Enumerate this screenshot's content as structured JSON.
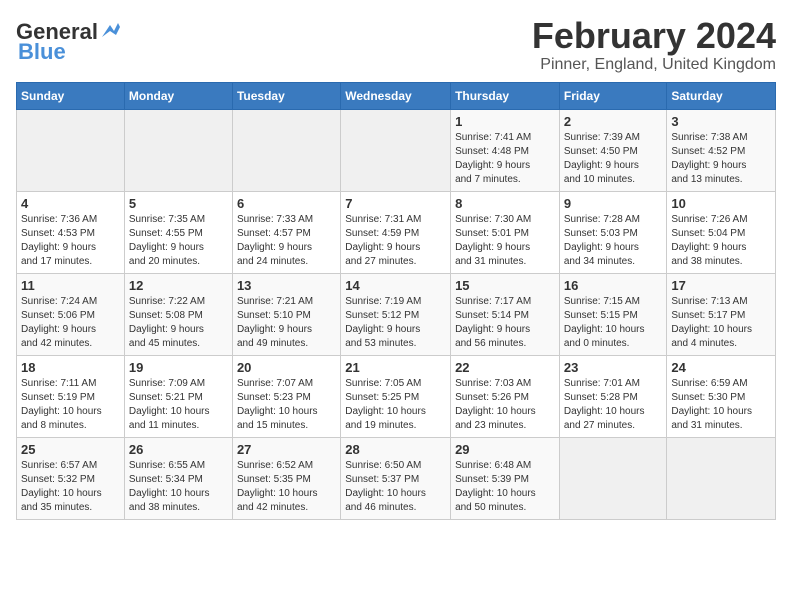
{
  "header": {
    "logo_line1": "General",
    "logo_line2": "Blue",
    "title": "February 2024",
    "subtitle": "Pinner, England, United Kingdom"
  },
  "calendar": {
    "columns": [
      "Sunday",
      "Monday",
      "Tuesday",
      "Wednesday",
      "Thursday",
      "Friday",
      "Saturday"
    ],
    "weeks": [
      [
        {
          "day": "",
          "info": ""
        },
        {
          "day": "",
          "info": ""
        },
        {
          "day": "",
          "info": ""
        },
        {
          "day": "",
          "info": ""
        },
        {
          "day": "1",
          "info": "Sunrise: 7:41 AM\nSunset: 4:48 PM\nDaylight: 9 hours\nand 7 minutes."
        },
        {
          "day": "2",
          "info": "Sunrise: 7:39 AM\nSunset: 4:50 PM\nDaylight: 9 hours\nand 10 minutes."
        },
        {
          "day": "3",
          "info": "Sunrise: 7:38 AM\nSunset: 4:52 PM\nDaylight: 9 hours\nand 13 minutes."
        }
      ],
      [
        {
          "day": "4",
          "info": "Sunrise: 7:36 AM\nSunset: 4:53 PM\nDaylight: 9 hours\nand 17 minutes."
        },
        {
          "day": "5",
          "info": "Sunrise: 7:35 AM\nSunset: 4:55 PM\nDaylight: 9 hours\nand 20 minutes."
        },
        {
          "day": "6",
          "info": "Sunrise: 7:33 AM\nSunset: 4:57 PM\nDaylight: 9 hours\nand 24 minutes."
        },
        {
          "day": "7",
          "info": "Sunrise: 7:31 AM\nSunset: 4:59 PM\nDaylight: 9 hours\nand 27 minutes."
        },
        {
          "day": "8",
          "info": "Sunrise: 7:30 AM\nSunset: 5:01 PM\nDaylight: 9 hours\nand 31 minutes."
        },
        {
          "day": "9",
          "info": "Sunrise: 7:28 AM\nSunset: 5:03 PM\nDaylight: 9 hours\nand 34 minutes."
        },
        {
          "day": "10",
          "info": "Sunrise: 7:26 AM\nSunset: 5:04 PM\nDaylight: 9 hours\nand 38 minutes."
        }
      ],
      [
        {
          "day": "11",
          "info": "Sunrise: 7:24 AM\nSunset: 5:06 PM\nDaylight: 9 hours\nand 42 minutes."
        },
        {
          "day": "12",
          "info": "Sunrise: 7:22 AM\nSunset: 5:08 PM\nDaylight: 9 hours\nand 45 minutes."
        },
        {
          "day": "13",
          "info": "Sunrise: 7:21 AM\nSunset: 5:10 PM\nDaylight: 9 hours\nand 49 minutes."
        },
        {
          "day": "14",
          "info": "Sunrise: 7:19 AM\nSunset: 5:12 PM\nDaylight: 9 hours\nand 53 minutes."
        },
        {
          "day": "15",
          "info": "Sunrise: 7:17 AM\nSunset: 5:14 PM\nDaylight: 9 hours\nand 56 minutes."
        },
        {
          "day": "16",
          "info": "Sunrise: 7:15 AM\nSunset: 5:15 PM\nDaylight: 10 hours\nand 0 minutes."
        },
        {
          "day": "17",
          "info": "Sunrise: 7:13 AM\nSunset: 5:17 PM\nDaylight: 10 hours\nand 4 minutes."
        }
      ],
      [
        {
          "day": "18",
          "info": "Sunrise: 7:11 AM\nSunset: 5:19 PM\nDaylight: 10 hours\nand 8 minutes."
        },
        {
          "day": "19",
          "info": "Sunrise: 7:09 AM\nSunset: 5:21 PM\nDaylight: 10 hours\nand 11 minutes."
        },
        {
          "day": "20",
          "info": "Sunrise: 7:07 AM\nSunset: 5:23 PM\nDaylight: 10 hours\nand 15 minutes."
        },
        {
          "day": "21",
          "info": "Sunrise: 7:05 AM\nSunset: 5:25 PM\nDaylight: 10 hours\nand 19 minutes."
        },
        {
          "day": "22",
          "info": "Sunrise: 7:03 AM\nSunset: 5:26 PM\nDaylight: 10 hours\nand 23 minutes."
        },
        {
          "day": "23",
          "info": "Sunrise: 7:01 AM\nSunset: 5:28 PM\nDaylight: 10 hours\nand 27 minutes."
        },
        {
          "day": "24",
          "info": "Sunrise: 6:59 AM\nSunset: 5:30 PM\nDaylight: 10 hours\nand 31 minutes."
        }
      ],
      [
        {
          "day": "25",
          "info": "Sunrise: 6:57 AM\nSunset: 5:32 PM\nDaylight: 10 hours\nand 35 minutes."
        },
        {
          "day": "26",
          "info": "Sunrise: 6:55 AM\nSunset: 5:34 PM\nDaylight: 10 hours\nand 38 minutes."
        },
        {
          "day": "27",
          "info": "Sunrise: 6:52 AM\nSunset: 5:35 PM\nDaylight: 10 hours\nand 42 minutes."
        },
        {
          "day": "28",
          "info": "Sunrise: 6:50 AM\nSunset: 5:37 PM\nDaylight: 10 hours\nand 46 minutes."
        },
        {
          "day": "29",
          "info": "Sunrise: 6:48 AM\nSunset: 5:39 PM\nDaylight: 10 hours\nand 50 minutes."
        },
        {
          "day": "",
          "info": ""
        },
        {
          "day": "",
          "info": ""
        }
      ]
    ]
  }
}
